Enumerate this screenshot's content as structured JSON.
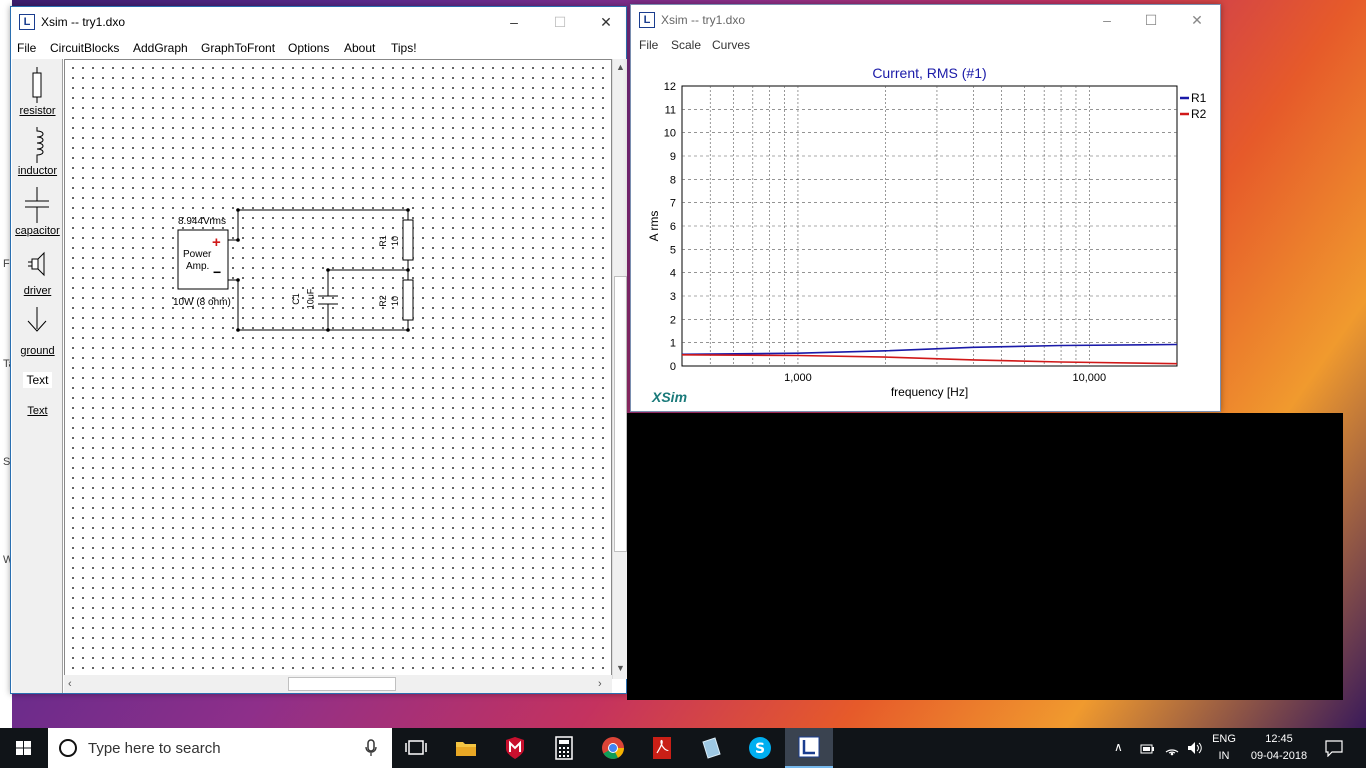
{
  "left_window": {
    "title": "Xsim -- try1.dxo",
    "menu": [
      "File",
      "CircuitBlocks",
      "AddGraph",
      "GraphToFront",
      "Options",
      "About",
      "Tips!"
    ],
    "tools": [
      {
        "label": "resistor",
        "icon": "resistor-icon"
      },
      {
        "label": "inductor",
        "icon": "inductor-icon"
      },
      {
        "label": "capacitor",
        "icon": "capacitor-icon"
      },
      {
        "label": "driver",
        "icon": "speaker-driver-icon"
      },
      {
        "label": "ground",
        "icon": "ground-icon"
      },
      {
        "label": "Text",
        "icon": "text-box-icon"
      }
    ],
    "schematic": {
      "amp_voltage": "8.944Vrms",
      "amp_label_line1": "Power",
      "amp_label_line2": "Amp.",
      "amp_plus": "+",
      "amp_minus": "−",
      "amp_power": "10W (8 ohm)",
      "r1_name": "R1",
      "r1_value": "10",
      "r2_name": "R2",
      "r2_value": "10",
      "c1_name": "C1",
      "c1_value": "10uF"
    }
  },
  "right_window": {
    "title": "Xsim -- try1.dxo",
    "menu": [
      "File",
      "Scale",
      "Curves"
    ],
    "brand": "XSim"
  },
  "chart_data": {
    "type": "line",
    "title": "Current, RMS (#1)",
    "xlabel": "frequency [Hz]",
    "ylabel": "A rms",
    "x_scale": "log",
    "xlim": [
      400,
      20000
    ],
    "ylim": [
      0,
      12
    ],
    "x_tick_labels": [
      "1,000",
      "10,000"
    ],
    "y_tick_labels": [
      "0",
      "1",
      "2",
      "3",
      "4",
      "5",
      "6",
      "7",
      "8",
      "9",
      "10",
      "11",
      "12"
    ],
    "grid": true,
    "legend": "right",
    "series": [
      {
        "name": "R1",
        "color": "#1a1aa8",
        "x": [
          400,
          1000,
          2000,
          4000,
          8000,
          20000
        ],
        "y": [
          0.5,
          0.55,
          0.65,
          0.8,
          0.88,
          0.92
        ]
      },
      {
        "name": "R2",
        "color": "#d01818",
        "x": [
          400,
          1000,
          2000,
          4000,
          8000,
          20000
        ],
        "y": [
          0.48,
          0.45,
          0.38,
          0.26,
          0.17,
          0.1
        ]
      }
    ]
  },
  "taskbar": {
    "search_placeholder": "Type here to search",
    "lang_line1": "ENG",
    "lang_line2": "IN",
    "time": "12:45",
    "date": "09-04-2018"
  }
}
